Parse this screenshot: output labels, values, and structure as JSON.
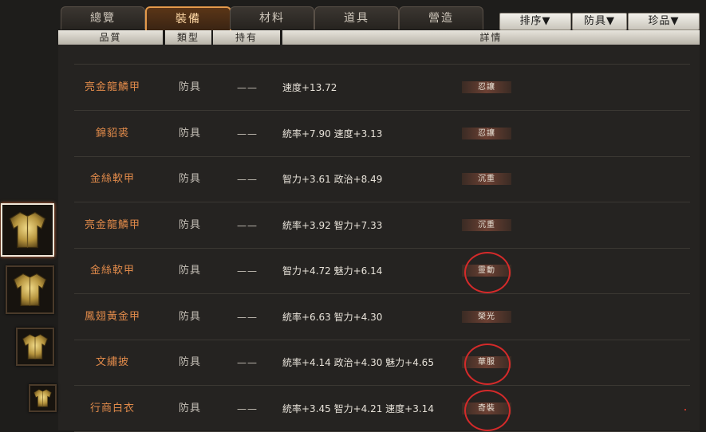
{
  "tabs": [
    {
      "label": "總覽"
    },
    {
      "label": "裝備",
      "active": true
    },
    {
      "label": "材料"
    },
    {
      "label": "道具"
    },
    {
      "label": "營造"
    }
  ],
  "sort_buttons": [
    {
      "label": "排序▼"
    },
    {
      "label": "防具▼"
    },
    {
      "label": "珍品▼"
    }
  ],
  "columns": {
    "quality": "品質",
    "type": "類型",
    "owned": "持有",
    "details": "詳情"
  },
  "items": [
    {
      "name": "亮金龍鱗甲",
      "type": "防具",
      "owned": "——",
      "stats": "速度+13.72",
      "tag": "忍讓",
      "circled": false
    },
    {
      "name": "錦貂裘",
      "type": "防具",
      "owned": "——",
      "stats": "統率+7.90  速度+3.13",
      "tag": "忍讓",
      "circled": false
    },
    {
      "name": "金絲軟甲",
      "type": "防具",
      "owned": "——",
      "stats": "智力+3.61  政治+8.49",
      "tag": "沉重",
      "circled": false
    },
    {
      "name": "亮金龍鱗甲",
      "type": "防具",
      "owned": "——",
      "stats": "統率+3.92  智力+7.33",
      "tag": "沉重",
      "circled": false
    },
    {
      "name": "金絲軟甲",
      "type": "防具",
      "owned": "——",
      "stats": "智力+4.72  魅力+6.14",
      "tag": "靈動",
      "circled": true
    },
    {
      "name": "鳳翅黃金甲",
      "type": "防具",
      "owned": "——",
      "stats": "統率+6.63  智力+4.30",
      "tag": "榮光",
      "circled": false
    },
    {
      "name": "文繡披",
      "type": "防具",
      "owned": "——",
      "stats": "統率+4.14  政治+4.30  魅力+4.65",
      "tag": "華服",
      "circled": true
    },
    {
      "name": "行商白衣",
      "type": "防具",
      "owned": "——",
      "stats": "統率+3.45  智力+4.21  速度+3.14",
      "tag": "奇裝",
      "circled": true
    }
  ],
  "thumbnails": [
    {
      "icon": "golden-armor-icon",
      "selected": true
    },
    {
      "icon": "golden-armor-icon",
      "selected": false
    },
    {
      "icon": "golden-armor-icon",
      "selected": false
    },
    {
      "icon": "golden-armor-icon",
      "selected": false
    }
  ],
  "colors": {
    "item_name": "#e08a4a",
    "active_tab_border": "#e49a4b",
    "highlight_circle": "#d42a2a"
  }
}
